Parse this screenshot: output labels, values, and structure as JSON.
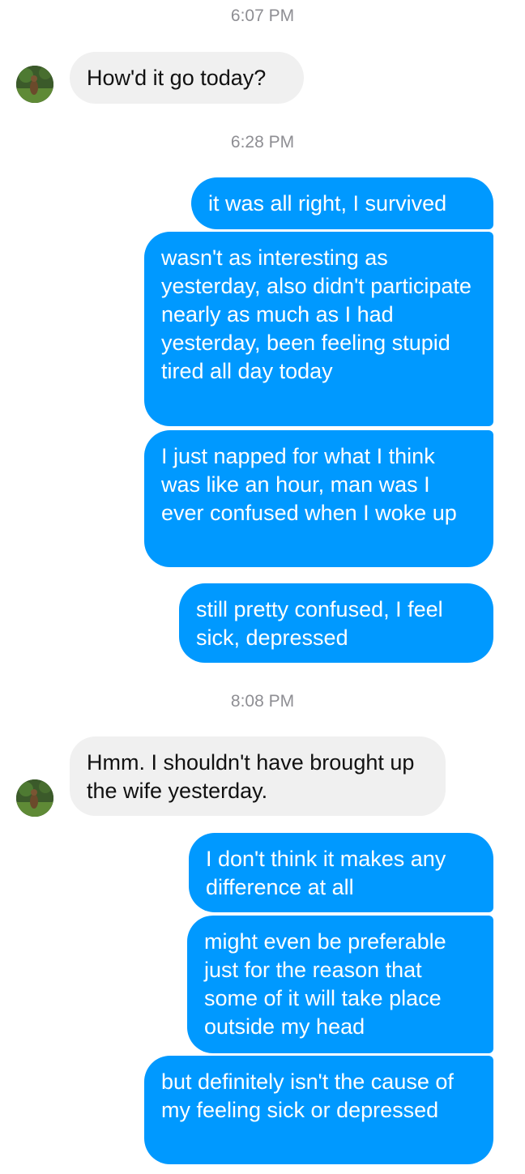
{
  "conversation": [
    {
      "kind": "timestamp",
      "text": "6:07 PM"
    },
    {
      "kind": "incoming",
      "text": "How'd it go today?"
    },
    {
      "kind": "timestamp",
      "text": "6:28 PM"
    },
    {
      "kind": "outgoing",
      "text": "it was all right, I survived"
    },
    {
      "kind": "outgoing",
      "text": "wasn't as interesting as yesterday, also didn't participate nearly as much as I had yesterday, been feeling stupid tired all day today"
    },
    {
      "kind": "outgoing",
      "text": "I just napped for what I think was like an hour, man was I ever confused when I woke up"
    },
    {
      "kind": "outgoing",
      "text": "still pretty confused, I feel sick, depressed"
    },
    {
      "kind": "timestamp",
      "text": "8:08 PM"
    },
    {
      "kind": "incoming",
      "text": "Hmm. I shouldn't have brought up the wife yesterday."
    },
    {
      "kind": "outgoing",
      "text": "I don't think it makes any difference at all"
    },
    {
      "kind": "outgoing",
      "text": "might even be preferable just for the reason that some of it will take place outside my head"
    },
    {
      "kind": "outgoing",
      "text": "but definitely isn't the cause of my feeling sick or depressed"
    }
  ],
  "contact": {
    "avatar_icon": "contact-avatar-photo"
  },
  "colors": {
    "outgoing_bubble": "#0099ff",
    "incoming_bubble": "#f0f0f0",
    "timestamp": "#8e8e93"
  }
}
